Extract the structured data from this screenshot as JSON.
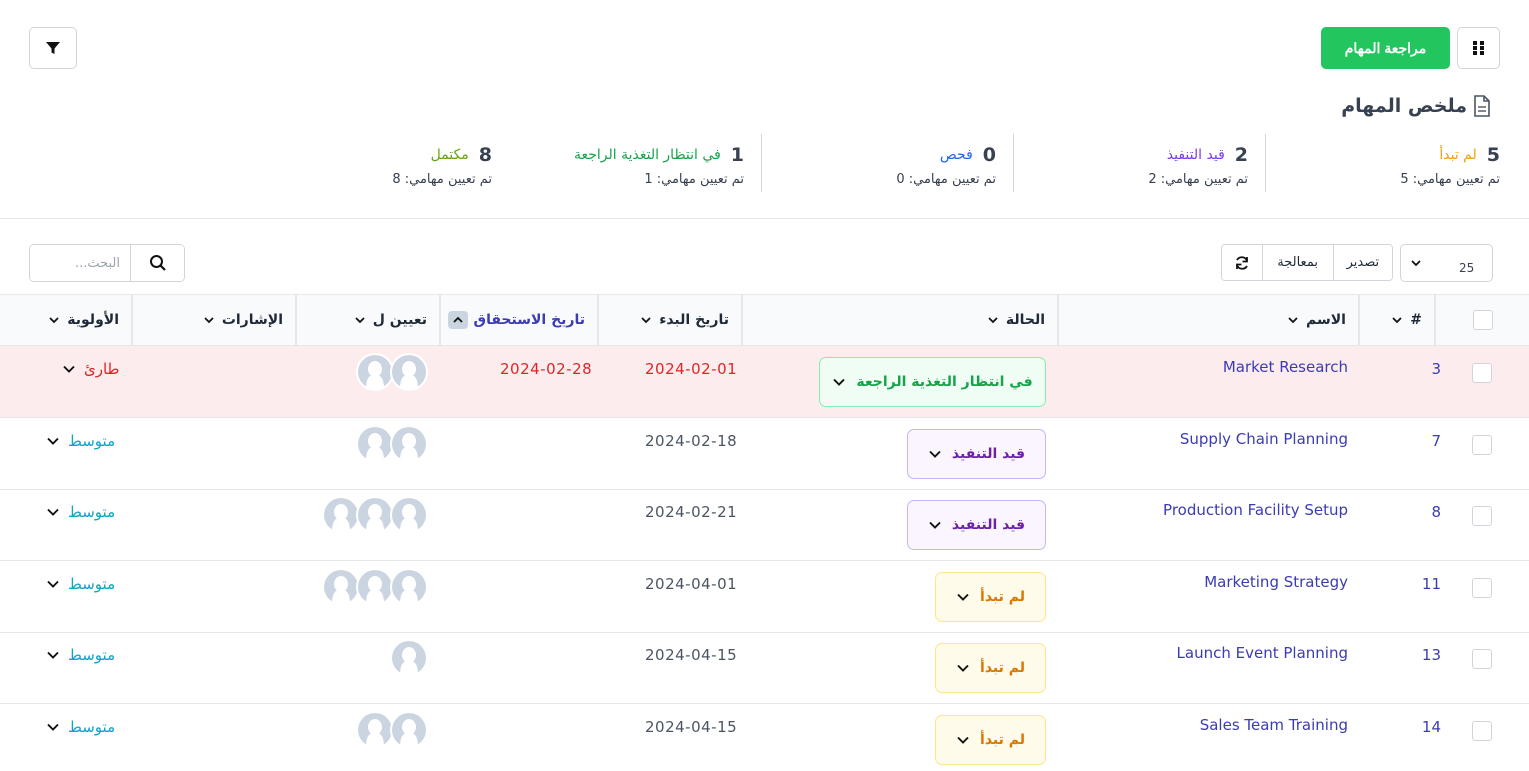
{
  "toolbar": {
    "review_label": "مراجعة المهام",
    "grid_icon": "grid-icon",
    "filter_icon": "filter-icon"
  },
  "summary": {
    "title": "ملخص المهام",
    "stats": [
      {
        "count": "5",
        "label": "لم تبدأ",
        "color": "#f59e0b",
        "sub": "تم تعيين مهامي: 5"
      },
      {
        "count": "2",
        "label": "قيد التنفيذ",
        "color": "#7c3aed",
        "sub": "تم تعيين مهامي: 2"
      },
      {
        "count": "0",
        "label": "فحص",
        "color": "#2563eb",
        "sub": "تم تعيين مهامي: 0"
      },
      {
        "count": "1",
        "label": "في انتظار التغذية الراجعة",
        "color": "#16a34a",
        "sub": "تم تعيين مهامي: 1"
      },
      {
        "count": "8",
        "label": "مكتمل",
        "color": "#65a30d",
        "sub": "تم تعيين مهامي: 8"
      }
    ]
  },
  "list_controls": {
    "page_size": "25",
    "export_label": "تصدير",
    "bulk_label": "بمعالجة",
    "search_placeholder": "البحث..."
  },
  "table": {
    "headers": {
      "id": "#",
      "name": "الاسم",
      "status": "الحالة",
      "start_date": "تاريخ البدء",
      "due_date": "تاريخ الاستحقاق",
      "assigned": "تعيين ل",
      "tags": "الإشارات",
      "priority": "الأولوية"
    },
    "rows": [
      {
        "id": "3",
        "name": "Market Research",
        "status": "في انتظار التغذية الراجعة",
        "status_kind": "feedback",
        "start": "2024-02-01",
        "due": "2024-02-28",
        "avatars": 2,
        "priority": "طارئ",
        "priority_kind": "urgent",
        "overdue": true
      },
      {
        "id": "7",
        "name": "Supply Chain Planning",
        "status": "قيد التنفيذ",
        "status_kind": "progress",
        "start": "2024-02-18",
        "due": "",
        "avatars": 2,
        "priority": "متوسط",
        "priority_kind": "medium",
        "overdue": false
      },
      {
        "id": "8",
        "name": "Production Facility Setup",
        "status": "قيد التنفيذ",
        "status_kind": "progress",
        "start": "2024-02-21",
        "due": "",
        "avatars": 3,
        "priority": "متوسط",
        "priority_kind": "medium",
        "overdue": false
      },
      {
        "id": "11",
        "name": "Marketing Strategy",
        "status": "لم تبدأ",
        "status_kind": "notstarted",
        "start": "2024-04-01",
        "due": "",
        "avatars": 3,
        "priority": "متوسط",
        "priority_kind": "medium",
        "overdue": false
      },
      {
        "id": "13",
        "name": "Launch Event Planning",
        "status": "لم تبدأ",
        "status_kind": "notstarted",
        "start": "2024-04-15",
        "due": "",
        "avatars": 1,
        "priority": "متوسط",
        "priority_kind": "medium",
        "overdue": false
      },
      {
        "id": "14",
        "name": "Sales Team Training",
        "status": "لم تبدأ",
        "status_kind": "notstarted",
        "start": "2024-04-15",
        "due": "",
        "avatars": 2,
        "priority": "متوسط",
        "priority_kind": "medium",
        "overdue": false
      }
    ]
  }
}
